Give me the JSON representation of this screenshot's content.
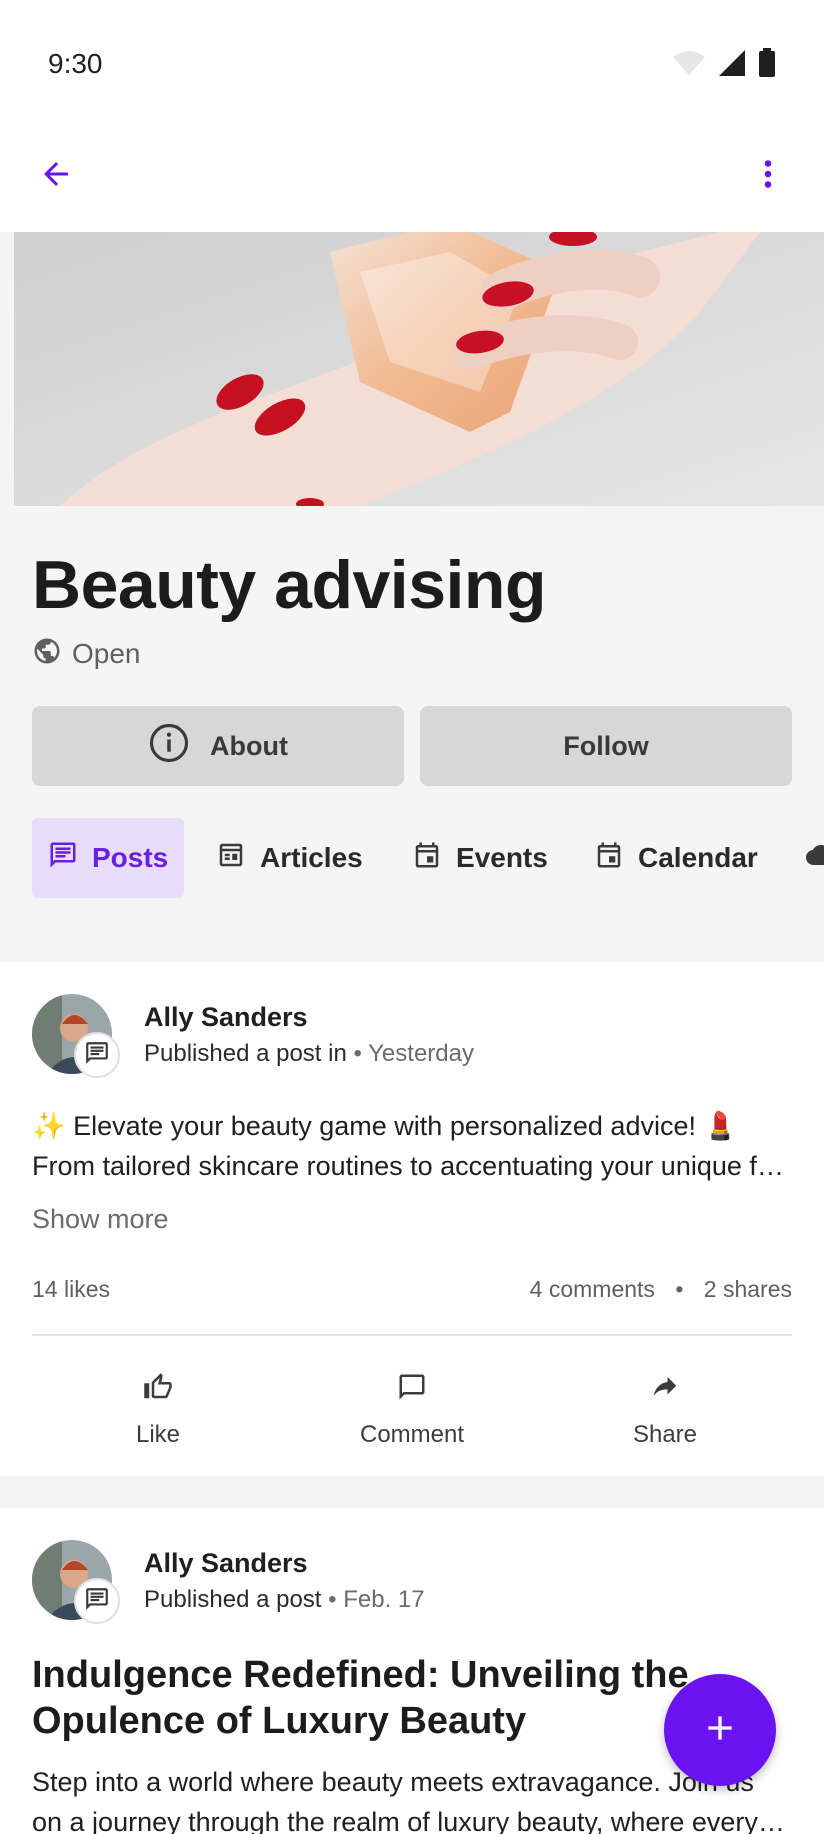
{
  "status_bar": {
    "time": "9:30"
  },
  "group": {
    "title": "Beauty advising",
    "privacy": "Open",
    "about_label": "About",
    "follow_label": "Follow"
  },
  "tabs": [
    {
      "label": "Posts",
      "icon": "chat-icon",
      "active": true
    },
    {
      "label": "Articles",
      "icon": "article-icon"
    },
    {
      "label": "Events",
      "icon": "event-icon"
    },
    {
      "label": "Calendar",
      "icon": "calendar-icon"
    }
  ],
  "posts": [
    {
      "author": "Ally Sanders",
      "action": "Published a post in",
      "separator": "•",
      "time": "Yesterday",
      "body_line1": "✨ Elevate your beauty game with personalized advice! 💄",
      "body_line2": "From tailored skincare routines to accentuating your unique features",
      "show_more": "Show more",
      "likes": "14 likes",
      "comments": "4 comments",
      "stat_separator": "•",
      "shares": "2 shares",
      "like_label": "Like",
      "comment_label": "Comment",
      "share_label": "Share"
    },
    {
      "author": "Ally Sanders",
      "action": "Published a post",
      "separator": "•",
      "time": "Feb. 17",
      "title": "Indulgence Redefined: Unveiling the Opulence of Luxury Beauty",
      "body_line1": "Step into a world where beauty meets extravagance. Join us",
      "body_line2": "on a journey through the realm of luxury beauty, where every detail"
    }
  ],
  "colors": {
    "accent": "#6a12f0",
    "active_tab_bg": "#e8dcfb",
    "button_bg": "#d7d7d7",
    "header_bg": "#f5f5f5"
  }
}
